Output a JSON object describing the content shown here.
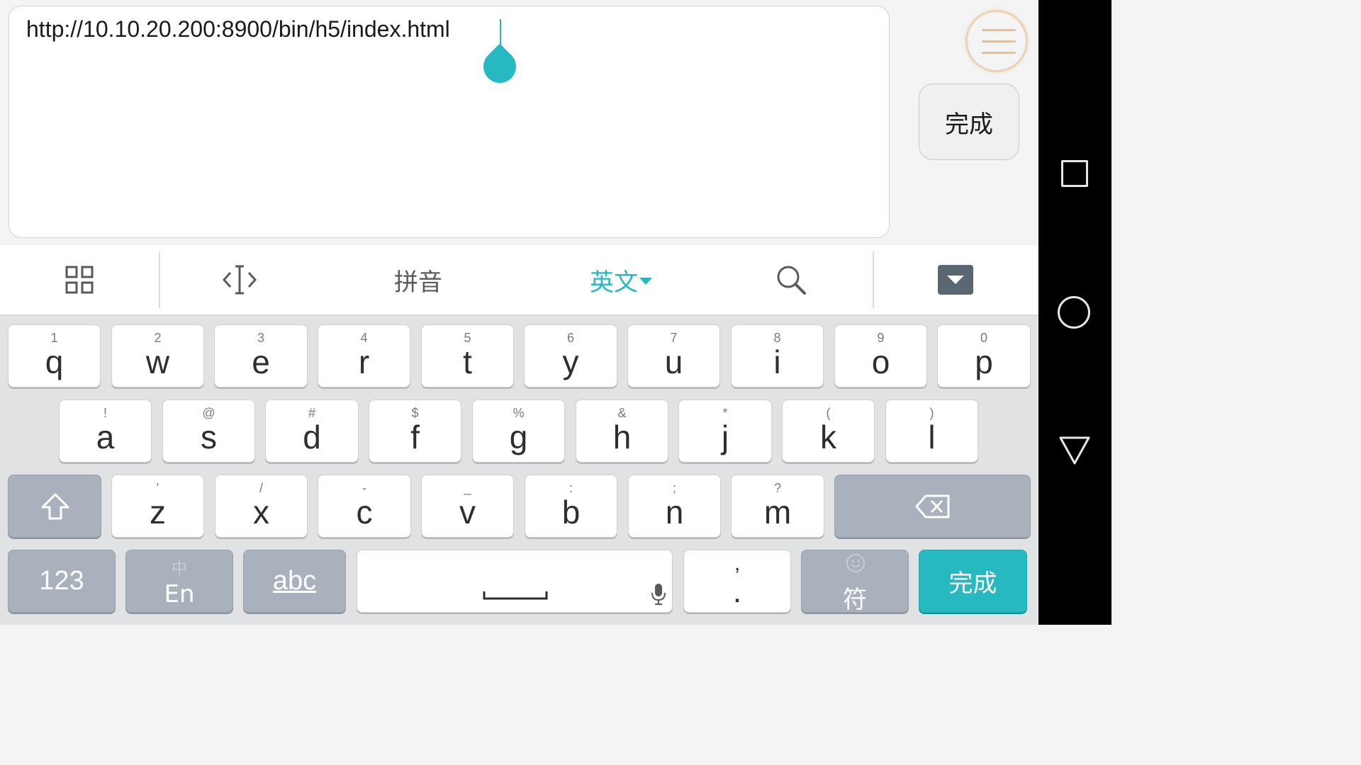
{
  "editor": {
    "url_value": "http://10.10.20.200:8900/bin/h5/index.html",
    "done_label": "完成"
  },
  "ime_toolbar": {
    "items": [
      {
        "name": "grid-menu",
        "icon": "grid-icon"
      },
      {
        "name": "cursor-move",
        "icon": "text-cursor-icon"
      },
      {
        "name": "pinyin",
        "label": "拼音"
      },
      {
        "name": "english",
        "label": "英文"
      },
      {
        "name": "search",
        "icon": "search-icon"
      },
      {
        "name": "hide-keyboard",
        "icon": "hide-keyboard-icon"
      }
    ],
    "active_color": "#26b9c2"
  },
  "keyboard": {
    "row1": [
      {
        "key": "q",
        "hint": "1"
      },
      {
        "key": "w",
        "hint": "2"
      },
      {
        "key": "e",
        "hint": "3"
      },
      {
        "key": "r",
        "hint": "4"
      },
      {
        "key": "t",
        "hint": "5"
      },
      {
        "key": "y",
        "hint": "6"
      },
      {
        "key": "u",
        "hint": "7"
      },
      {
        "key": "i",
        "hint": "8"
      },
      {
        "key": "o",
        "hint": "9"
      },
      {
        "key": "p",
        "hint": "0"
      }
    ],
    "row2": [
      {
        "key": "a",
        "hint": "!"
      },
      {
        "key": "s",
        "hint": "@"
      },
      {
        "key": "d",
        "hint": "#"
      },
      {
        "key": "f",
        "hint": "$"
      },
      {
        "key": "g",
        "hint": "%"
      },
      {
        "key": "h",
        "hint": "&"
      },
      {
        "key": "j",
        "hint": "*"
      },
      {
        "key": "k",
        "hint": "("
      },
      {
        "key": "l",
        "hint": ")"
      }
    ],
    "row3": [
      {
        "key": "z",
        "hint": "'"
      },
      {
        "key": "x",
        "hint": "/"
      },
      {
        "key": "c",
        "hint": "-"
      },
      {
        "key": "v",
        "hint": "_"
      },
      {
        "key": "b",
        "hint": ":"
      },
      {
        "key": "n",
        "hint": ";"
      },
      {
        "key": "m",
        "hint": "?"
      }
    ],
    "numbers_label": "123",
    "lang_top": "中",
    "lang_bottom": "En",
    "abc_label": "abc",
    "comma_label": ",",
    "period_label": ".",
    "symbols_label": "符",
    "done_label": "完成"
  },
  "colors": {
    "accent": "#26b9c2",
    "dark_key": "#a9b1bc",
    "keyboard_bg": "#e1e2e4"
  }
}
